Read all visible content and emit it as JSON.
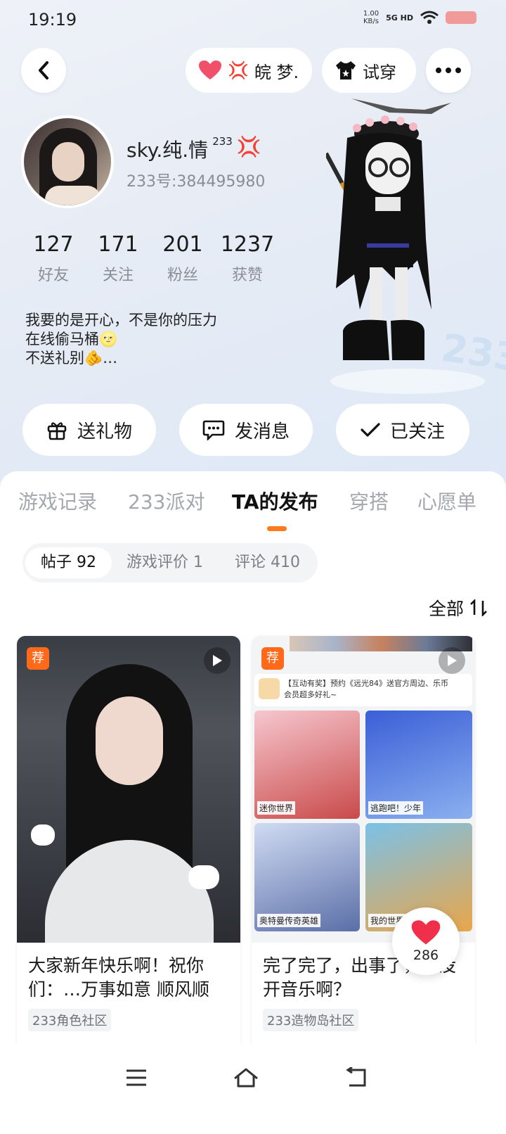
{
  "status": {
    "time": "19:19",
    "net_speed": "1.00",
    "net_unit": "KB/s",
    "signal": "5G HD"
  },
  "topbar": {
    "fan_label": "皖 梦.",
    "tryon_label": "试穿"
  },
  "profile": {
    "username": "sky.纯.情",
    "username_sup": "233",
    "uid": "233号:384495980",
    "stats": [
      {
        "num": "127",
        "label": "好友"
      },
      {
        "num": "171",
        "label": "关注"
      },
      {
        "num": "201",
        "label": "粉丝"
      },
      {
        "num": "1237",
        "label": "获赞"
      }
    ],
    "bio_lines": [
      "我要的是开心，不是你的压力",
      "在线偷马桶🌝",
      "不送礼别🫵…"
    ]
  },
  "actions": {
    "gift": "送礼物",
    "message": "发消息",
    "followed": "已关注"
  },
  "tabs": [
    "游戏记录",
    "233派对",
    "TA的发布",
    "穿搭",
    "心愿单"
  ],
  "subtabs": [
    "帖子 92",
    "游戏评价 1",
    "评论 410"
  ],
  "sort_label": "全部",
  "cards": [
    {
      "badge": "荐",
      "title": "大家新年快乐啊！祝你们：…万事如意  顺风顺",
      "tag": "233角色社区"
    },
    {
      "badge": "荐",
      "title": "完了完了，出事了，我没开音乐啊？",
      "tag": "233造物岛社区",
      "promo": "【互动有奖】预约《远光84》送官方周边、乐币会员超多好礼~",
      "games": [
        "迷你世界",
        "逃跑吧！少年",
        "奥特曼传奇英雄",
        "我的世界"
      ]
    }
  ],
  "like_count": "286",
  "colors": {
    "accent": "#ff7a1a",
    "heart": "#f0304a"
  }
}
